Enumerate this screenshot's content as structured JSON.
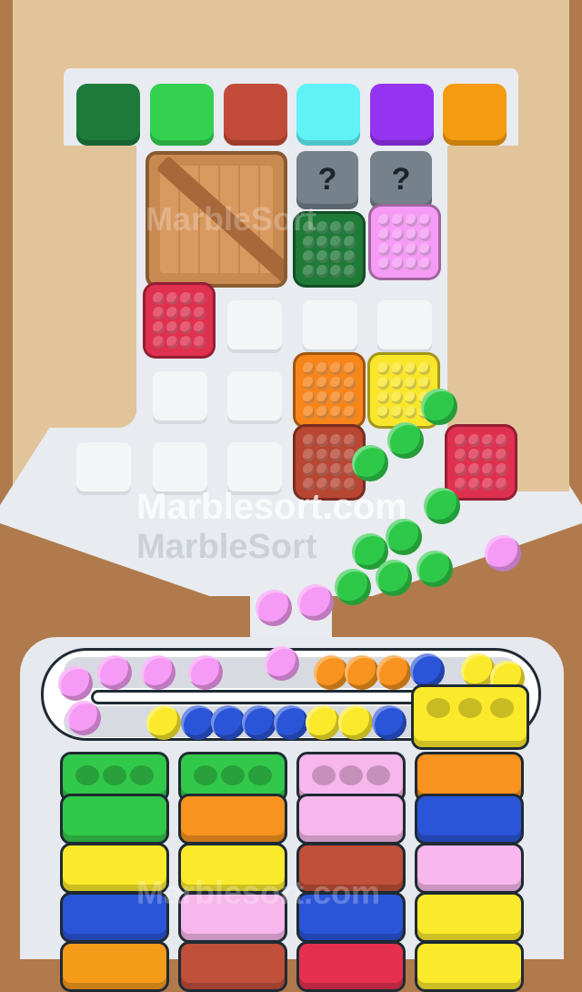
{
  "watermark": {
    "main": "Marblesort.com",
    "secondary": "MarbleSort",
    "faint_top": "MarbleSort",
    "faint_bottom": "Marblesort.com"
  },
  "goal_colors": [
    "#1d7a3b",
    "#33d14f",
    "#c24a38",
    "#5ff2f7",
    "#9433f0",
    "#f59b0f"
  ],
  "hidden_blocks": [
    {
      "label": "?"
    },
    {
      "label": "?"
    }
  ],
  "colors": {
    "board_frame": "#b07a4c",
    "board_inner": "#e2c49a",
    "tray": "#e6e9ee",
    "track": "#ffffff",
    "crate": "#c98a52"
  },
  "blocks": [
    {
      "color": "#1f7a38",
      "name": "dark-green"
    },
    {
      "color": "#f59bf5",
      "name": "pink"
    },
    {
      "color": "#e0304f",
      "name": "red"
    },
    {
      "color": "#f7851a",
      "name": "orange"
    },
    {
      "color": "#f9e62a",
      "name": "yellow"
    },
    {
      "color": "#b84632",
      "name": "brown"
    },
    {
      "color": "#e0304f",
      "name": "red"
    }
  ],
  "bottom_columns": [
    [
      "#32c94a",
      "#32c94a",
      "#fbea2b",
      "#2b55d8",
      "#f59b1a"
    ],
    [
      "#32c94a",
      "#f7931e",
      "#fbea2b",
      "#f7b6ec",
      "#c0503a"
    ],
    [
      "#f7b6ec",
      "#f7b6ec",
      "#c0503a",
      "#2b55d8",
      "#e5304f"
    ],
    [
      "#f7931e",
      "#2b55d8",
      "#f7b6ec",
      "#fbea2b",
      "#fbea2b"
    ]
  ]
}
